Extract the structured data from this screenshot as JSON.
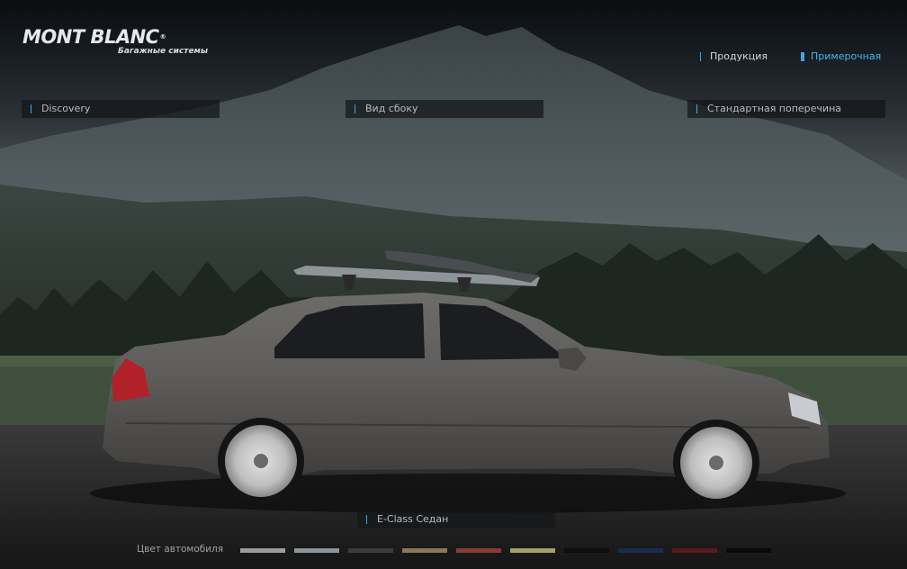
{
  "logo": {
    "brand": "MONT BLANC",
    "registered": "®",
    "tagline": "Багажные системы"
  },
  "nav": [
    {
      "label": "Продукция",
      "active": false
    },
    {
      "label": "Примерочная",
      "active": true
    }
  ],
  "selectors": {
    "model_line": "Discovery",
    "view": "Вид сбоку",
    "crossbar": "Стандартная поперечина",
    "car": "E-Class Седан"
  },
  "car_color": {
    "label": "Цвет автомобиля",
    "swatches": [
      "#9c9c9c",
      "#8c979c",
      "#3c3c3c",
      "#8a7658",
      "#8c3a34",
      "#a4a06a",
      "#0e0e0e",
      "#1a2a52",
      "#5a1a1e",
      "#0a0a0a"
    ]
  }
}
